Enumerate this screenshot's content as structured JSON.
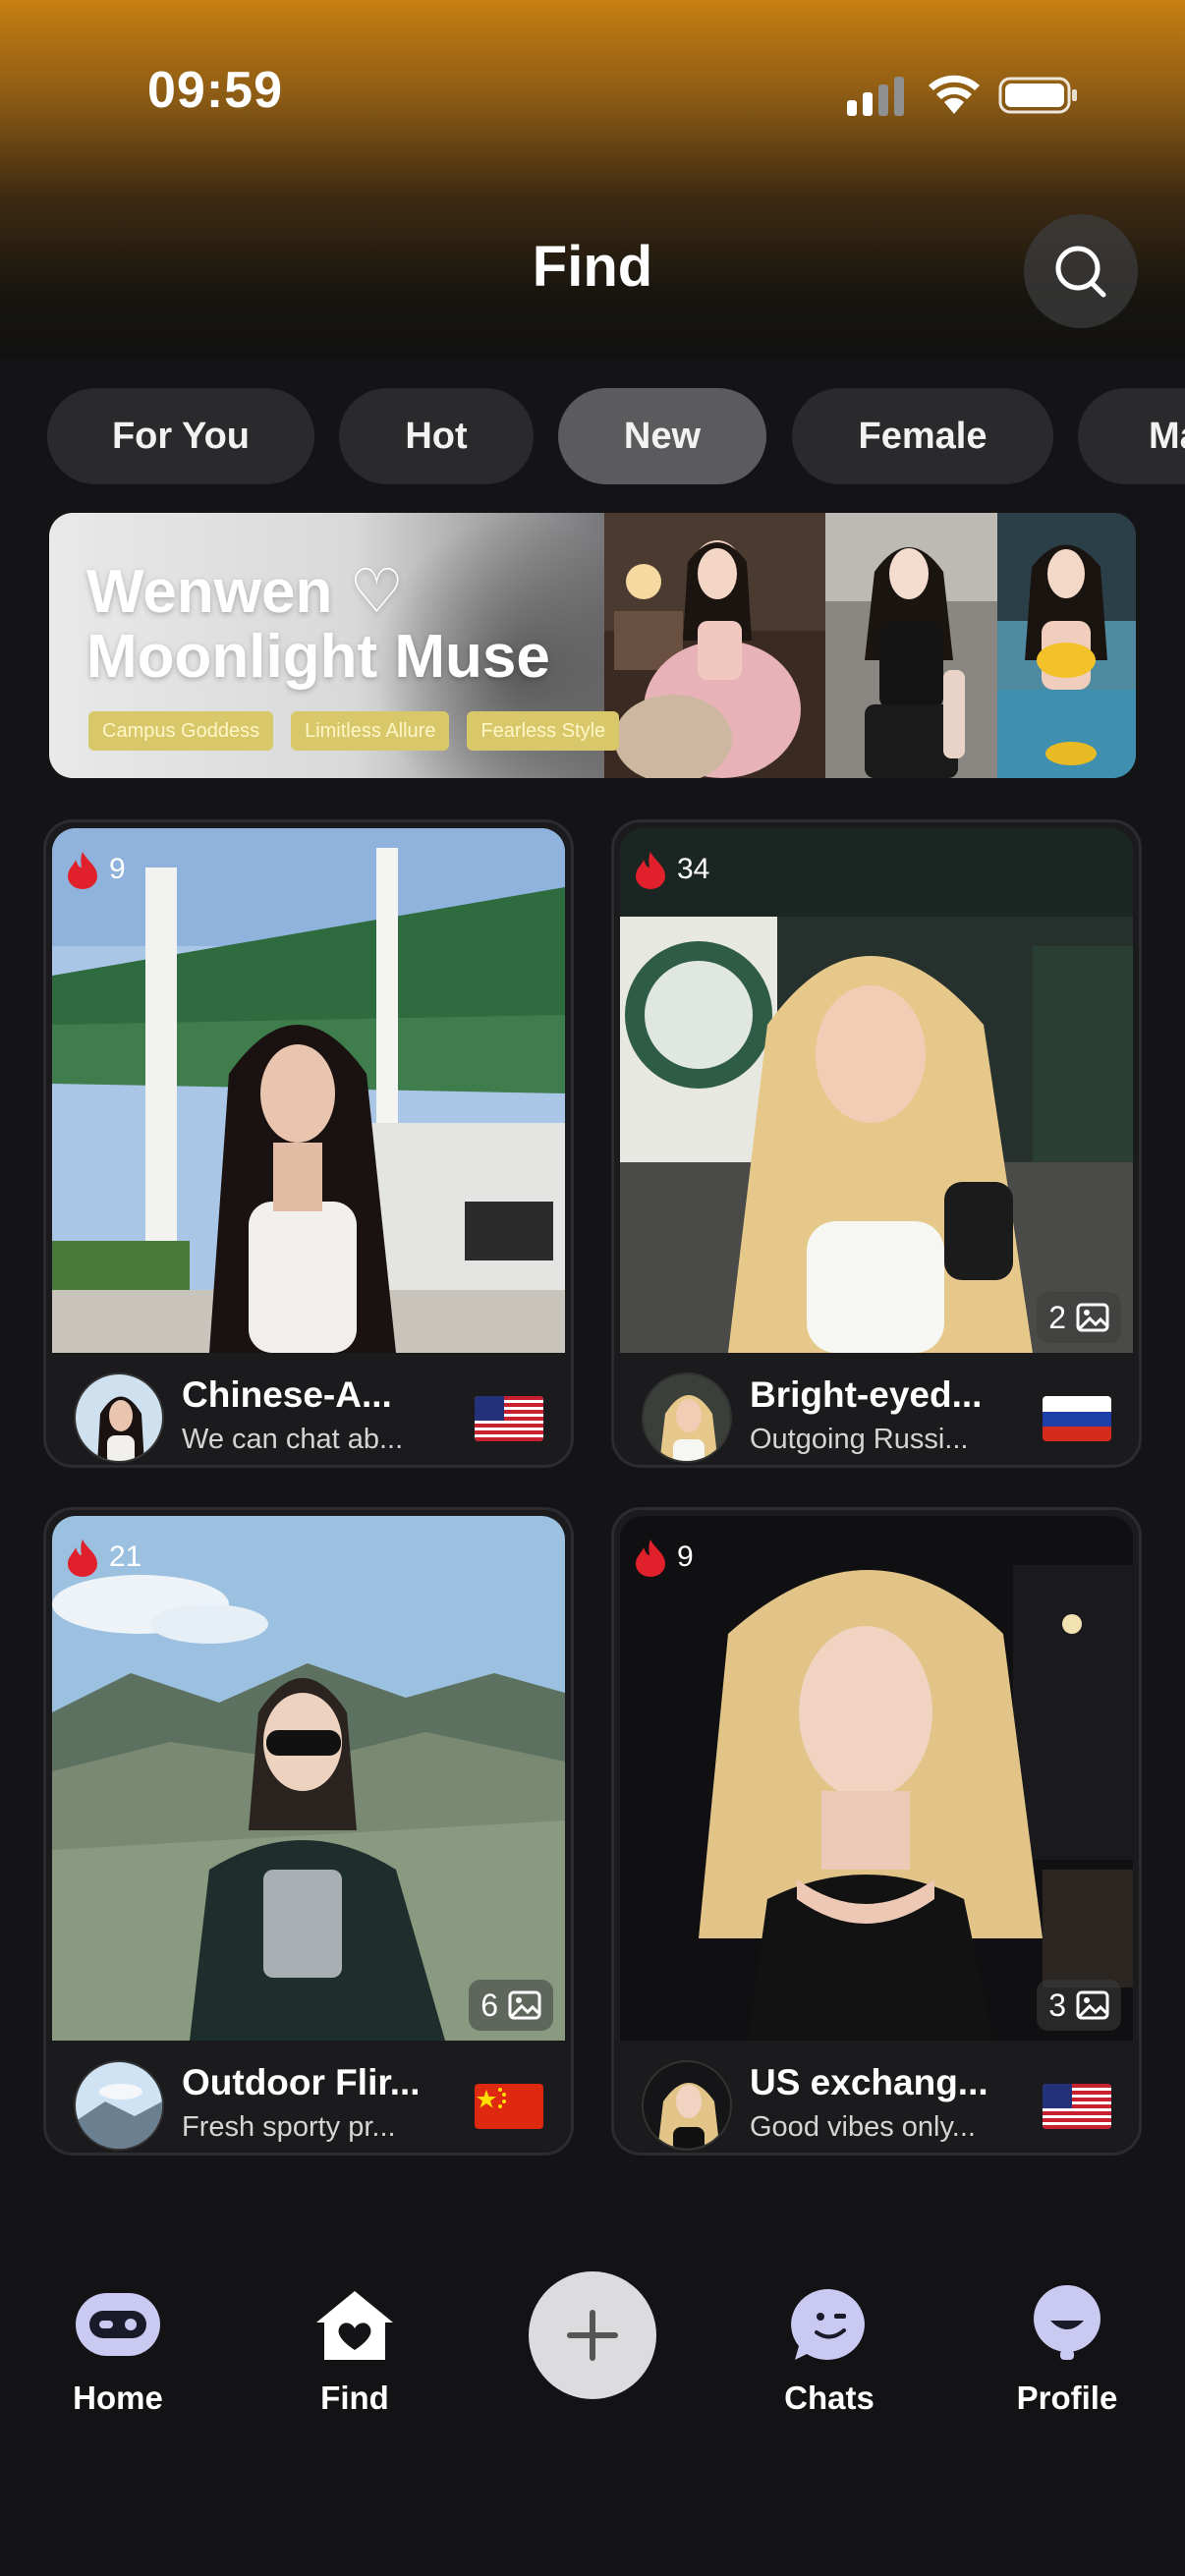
{
  "status_bar": {
    "time": "09:59"
  },
  "header": {
    "title": "Find"
  },
  "tabs": [
    {
      "label": "For You",
      "active": false
    },
    {
      "label": "Hot",
      "active": false
    },
    {
      "label": "New",
      "active": true
    },
    {
      "label": "Female",
      "active": false
    },
    {
      "label": "Ma",
      "active": false
    }
  ],
  "banner": {
    "title_line1": "Wenwen ♡",
    "title_line2": "Moonlight Muse",
    "tags": [
      "Campus Goddess",
      "Limitless Allure",
      "Fearless Style"
    ]
  },
  "cards": [
    {
      "heat": "9",
      "name": "Chinese-A...",
      "subtitle": "We can chat ab...",
      "flag": "us-flag",
      "photo_count": ""
    },
    {
      "heat": "34",
      "name": "Bright-eyed...",
      "subtitle": "Outgoing Russi...",
      "flag": "ru-flag",
      "photo_count": "2"
    },
    {
      "heat": "21",
      "name": "Outdoor Flir...",
      "subtitle": "Fresh sporty pr...",
      "flag": "cn-flag",
      "photo_count": "6"
    },
    {
      "heat": "9",
      "name": "US exchang...",
      "subtitle": "Good vibes only...",
      "flag": "us-flag",
      "photo_count": "3"
    }
  ],
  "bottom_nav": {
    "home": "Home",
    "find": "Find",
    "chats": "Chats",
    "profile": "Profile"
  },
  "colors": {
    "accent_flame": "#e0202a",
    "tab_active": "#5b5b5e",
    "tab_inactive": "#2a2a2d",
    "nav_icon": "#c9c9f2",
    "background": "#141417"
  }
}
